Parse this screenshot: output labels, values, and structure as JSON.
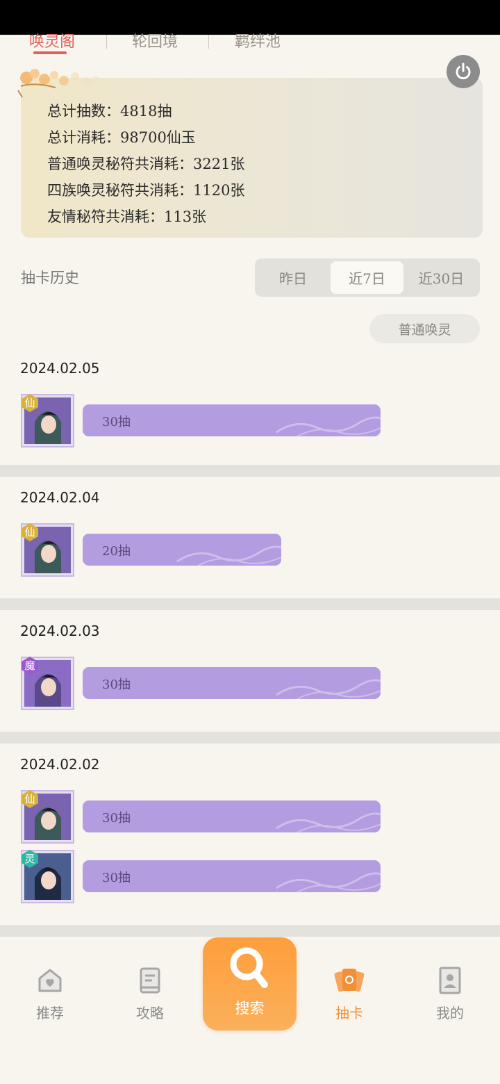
{
  "top_tabs": [
    "唤灵阁",
    "轮回境",
    "羁绊池"
  ],
  "stats": {
    "total_pulls": "总计抽数：4818抽",
    "total_cost": "总计消耗：98700仙玉",
    "normal_rune": "普通唤灵秘符共消耗：3221张",
    "clan_rune": "四族唤灵秘符共消耗：1120张",
    "friend_rune": "友情秘符共消耗：113张"
  },
  "history": {
    "label": "抽卡历史",
    "ranges": [
      "昨日",
      "近7日",
      "近30日"
    ],
    "selected_range": "近7日",
    "filter": "普通唤灵"
  },
  "records": [
    {
      "date": "2024.02.05",
      "entries": [
        {
          "badge": "仙",
          "pulls": "30抽",
          "fill": 0.75
        }
      ]
    },
    {
      "date": "2024.02.04",
      "entries": [
        {
          "badge": "仙",
          "pulls": "20抽",
          "fill": 0.5
        }
      ]
    },
    {
      "date": "2024.02.03",
      "entries": [
        {
          "badge": "魔",
          "pulls": "30抽",
          "fill": 0.75
        }
      ]
    },
    {
      "date": "2024.02.02",
      "entries": [
        {
          "badge": "仙",
          "pulls": "30抽",
          "fill": 0.75
        },
        {
          "badge": "灵",
          "pulls": "30抽",
          "fill": 0.75
        }
      ]
    }
  ],
  "bottom_nav": {
    "items": [
      "推荐",
      "攻略",
      "搜索",
      "抽卡",
      "我的"
    ],
    "active": "抽卡"
  },
  "colors": {
    "accent": "#e0605a",
    "bar": "#b39ce0",
    "nav_active": "#f0913a",
    "search_button": "#ff9e3c",
    "badge_xian": "#d9b23a",
    "badge_mo": "#9b59d0",
    "badge_ling": "#2fb8a8"
  }
}
